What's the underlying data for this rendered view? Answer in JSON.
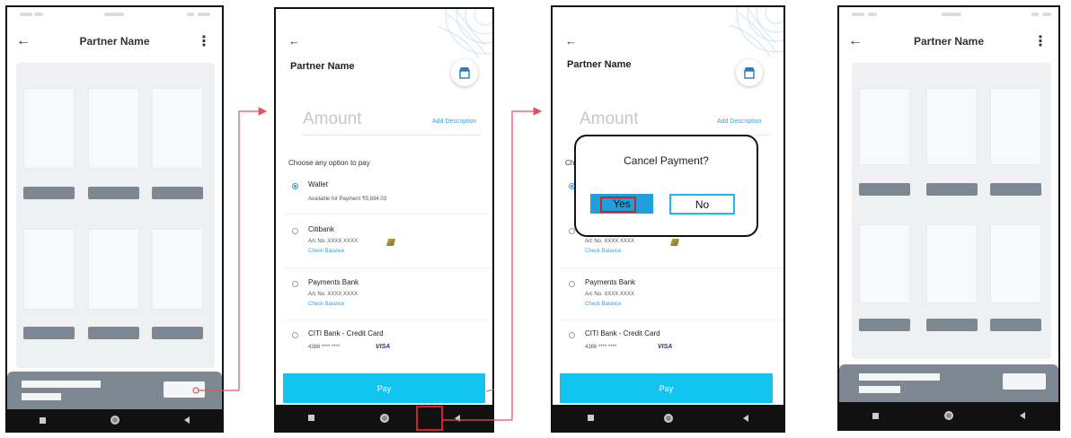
{
  "screen1": {
    "title": "Partner Name",
    "icons": {
      "back": "back-arrow-icon",
      "menu": "kebab-menu-icon"
    },
    "placeholder_tiles": 6
  },
  "screen2": {
    "partner_name": "Partner Name",
    "amount_placeholder": "Amount",
    "add_description": "Add Description",
    "choose_label": "Choose any option to pay",
    "options": [
      {
        "title": "Wallet",
        "line1": "Available for Payment ₹5,694.03",
        "line2": "",
        "selected": true
      },
      {
        "title": "Citibank",
        "line1": "A/c No.  XXXX XXXX",
        "line2": "Check Balance",
        "selected": false
      },
      {
        "title": "Payments Bank",
        "line1": "A/c No.  XXXX XXXX",
        "line2": "Check Balance",
        "selected": false
      },
      {
        "title": "CITI Bank - Credit Card",
        "line1": "4386 **** ****",
        "line2": "",
        "selected": false,
        "card": "VISA"
      }
    ],
    "pay_label": "Pay"
  },
  "screen3": {
    "partner_name": "Partner Name",
    "amount_placeholder": "Amount",
    "add_description": "Add Description",
    "choose_prefix": "Ch",
    "options_visible": [
      {
        "line1": "A/c No.  XXXX XXXX",
        "line2": "Check Balance"
      },
      {
        "title": "Payments Bank",
        "line1": "A/c No.  XXXX XXXX",
        "line2": "Check Balance"
      },
      {
        "title": "CITI Bank - Credit Card",
        "line1": "4386 **** ****",
        "card": "VISA"
      }
    ],
    "dialog": {
      "title": "Cancel Payment?",
      "yes": "Yes",
      "no": "No"
    },
    "pay_label": "Pay"
  },
  "screen4": {
    "title": "Partner Name"
  },
  "colors": {
    "accent": "#13c3f0",
    "highlight": "#d81e2a",
    "connector": "#e0545e",
    "placeholder_grey": "#7d8893"
  }
}
